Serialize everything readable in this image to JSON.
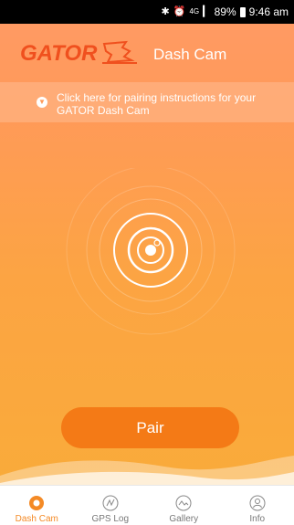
{
  "status_bar": {
    "network": "4G",
    "battery": "89%",
    "time": "9:46 am"
  },
  "header": {
    "logo_text": "GATOR",
    "title": "Dash Cam"
  },
  "banner": {
    "icon": "location-pin-icon",
    "text": "Click here for pairing instructions for your GATOR Dash Cam"
  },
  "main": {
    "camera_icon": "dash-cam-lens-icon",
    "pair_label": "Pair"
  },
  "tabs": [
    {
      "label": "Dash Cam",
      "icon": "dash-cam-icon",
      "active": true
    },
    {
      "label": "GPS Log",
      "icon": "gps-route-icon",
      "active": false
    },
    {
      "label": "Gallery",
      "icon": "gallery-icon",
      "active": false
    },
    {
      "label": "Info",
      "icon": "info-user-icon",
      "active": false
    }
  ],
  "colors": {
    "accent": "#f48a26",
    "button": "#f47a16",
    "gradient_top": "#ff9a63",
    "gradient_bottom": "#f9ab3a"
  }
}
